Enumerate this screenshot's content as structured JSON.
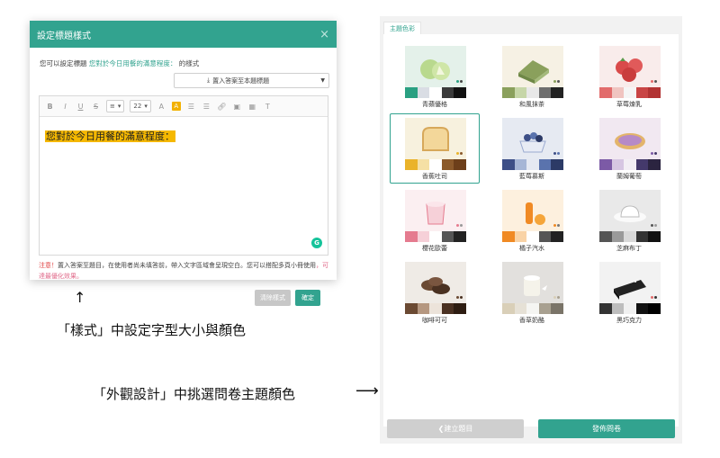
{
  "dialog": {
    "title": "設定標題樣式",
    "close_glyph": "×",
    "intro_prefix": "您可以設定標題",
    "intro_highlight": "您對於今日用餐的滿意程度：",
    "intro_suffix": "的樣式",
    "insert_select": "置入答案至本題標題",
    "toolbar": {
      "bold": "B",
      "italic": "I",
      "underline": "U",
      "strike": "S",
      "align": "≡",
      "font_size": "22",
      "text_color": "A",
      "bg_color": "A"
    },
    "editor_text": "您對於今日用餐的滿意程度：",
    "note_warn": "注意！",
    "note_text": "置入答案至題目，在使用者尚未填答前，帶入文字區域會呈現空白。您可以搭配多頁小冊使用",
    "note_tail": "，可達最優化效果。",
    "clear_button": "清除樣式",
    "ok_button": "確定"
  },
  "captions": {
    "arrow_up": "↑",
    "style_caption": "「樣式」中設定字型大小與顏色",
    "theme_caption": "「外觀設計」中挑選問卷主題顏色",
    "arrow_right": "⟶"
  },
  "theme_panel": {
    "tab_label": "主題色彩",
    "themes": [
      {
        "name": "青蘋優格",
        "icon": "green-apple-icon",
        "bg": "#e4f1ea",
        "swatches": [
          "#2aa082",
          "#d9dde4",
          "#ffffff",
          "#3b3b3b",
          "#111111"
        ],
        "dots": [
          "#2aa082",
          "#444444"
        ]
      },
      {
        "name": "和風抹茶",
        "icon": "matcha-cake-icon",
        "bg": "#f6f1e4",
        "swatches": [
          "#8aa05c",
          "#c6d6a8",
          "#e8e8e8",
          "#6e6e6e",
          "#222222"
        ],
        "dots": [
          "#8aa05c",
          "#555555"
        ]
      },
      {
        "name": "草莓煉乳",
        "icon": "strawberry-icon",
        "bg": "#f9eceb",
        "swatches": [
          "#e26b6b",
          "#f0c4c0",
          "#f5f5f5",
          "#c94545",
          "#b23333"
        ],
        "dots": [
          "#e26b6b",
          "#555555"
        ]
      },
      {
        "name": "香蕉吐司",
        "icon": "toast-icon",
        "bg": "#f7f1de",
        "swatches": [
          "#eab32a",
          "#f5e0a5",
          "#ffffff",
          "#8b5a2b",
          "#6d3f1a"
        ],
        "dots": [
          "#eab32a",
          "#8b5a2b"
        ]
      },
      {
        "name": "藍莓慕斯",
        "icon": "blueberry-mousse-icon",
        "bg": "#e6eaf2",
        "swatches": [
          "#3d4f87",
          "#a6b6d6",
          "#e5e9f2",
          "#5a73ad",
          "#2c3a66"
        ],
        "dots": [
          "#3d4f87",
          "#5a73ad"
        ]
      },
      {
        "name": "蘭姆葡萄",
        "icon": "raisin-tart-icon",
        "bg": "#f1e8f1",
        "swatches": [
          "#7c5aa6",
          "#d6c6e2",
          "#f2eef4",
          "#44396b",
          "#2b2440"
        ],
        "dots": [
          "#7c5aa6",
          "#44396b"
        ]
      },
      {
        "name": "櫻花歐蕾",
        "icon": "sakura-latte-icon",
        "bg": "#fbeff1",
        "swatches": [
          "#e57b8f",
          "#f6d0d8",
          "#ffffff",
          "#555555",
          "#222222"
        ],
        "dots": [
          "#e57b8f",
          "#999999"
        ]
      },
      {
        "name": "橘子汽水",
        "icon": "orange-soda-icon",
        "bg": "#fdf0de",
        "swatches": [
          "#f08a24",
          "#f9d3a6",
          "#ffffff",
          "#555555",
          "#222222"
        ],
        "dots": [
          "#f08a24",
          "#777777"
        ]
      },
      {
        "name": "芝麻布丁",
        "icon": "sesame-pudding-icon",
        "bg": "#e9e9e9",
        "swatches": [
          "#555555",
          "#9a9a9a",
          "#d9d9d9",
          "#333333",
          "#111111"
        ],
        "dots": [
          "#555555",
          "#999999"
        ]
      },
      {
        "name": "咖啡可可",
        "icon": "coffee-cocoa-icon",
        "bg": "#efebe6",
        "swatches": [
          "#6b4a33",
          "#b59780",
          "#ece3da",
          "#4a3122",
          "#2e1d12"
        ],
        "dots": [
          "#6b4a33",
          "#4a3122"
        ]
      },
      {
        "name": "香草奶酪",
        "icon": "vanilla-pannacotta-icon",
        "bg": "#e2e0dd",
        "swatches": [
          "#d9cfb8",
          "#e6e1d6",
          "#f5f5f2",
          "#a8a090",
          "#7a7468"
        ],
        "dots": [
          "#d9cfb8",
          "#a8a090"
        ]
      },
      {
        "name": "黑巧克力",
        "icon": "dark-chocolate-icon",
        "bg": "#f2f2f2",
        "swatches": [
          "#333333",
          "#bdbdbd",
          "#f0f0f0",
          "#111111",
          "#000000"
        ],
        "dots": [
          "#e26b6b",
          "#333333"
        ]
      }
    ],
    "back_button": "❮建立題目",
    "publish_button": "發佈問卷"
  },
  "colors": {
    "accent": "#32a38f",
    "highlight": "#f5b800",
    "warn": "#e04444"
  }
}
